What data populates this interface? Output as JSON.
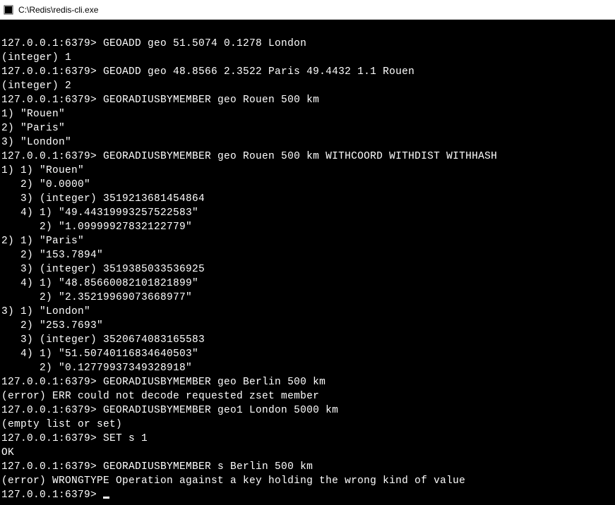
{
  "window": {
    "title": "C:\\Redis\\redis-cli.exe"
  },
  "terminal": {
    "prompt": "127.0.0.1:6379> ",
    "lines": [
      "127.0.0.1:6379> GEOADD geo 51.5074 0.1278 London",
      "(integer) 1",
      "127.0.0.1:6379> GEOADD geo 48.8566 2.3522 Paris 49.4432 1.1 Rouen",
      "(integer) 2",
      "127.0.0.1:6379> GEORADIUSBYMEMBER geo Rouen 500 km",
      "1) \"Rouen\"",
      "2) \"Paris\"",
      "3) \"London\"",
      "127.0.0.1:6379> GEORADIUSBYMEMBER geo Rouen 500 km WITHCOORD WITHDIST WITHHASH",
      "1) 1) \"Rouen\"",
      "   2) \"0.0000\"",
      "   3) (integer) 3519213681454864",
      "   4) 1) \"49.44319993257522583\"",
      "      2) \"1.09999927832122779\"",
      "2) 1) \"Paris\"",
      "   2) \"153.7894\"",
      "   3) (integer) 3519385033536925",
      "   4) 1) \"48.85660082101821899\"",
      "      2) \"2.35219969073668977\"",
      "3) 1) \"London\"",
      "   2) \"253.7693\"",
      "   3) (integer) 3520674083165583",
      "   4) 1) \"51.50740116834640503\"",
      "      2) \"0.12779937349328918\"",
      "127.0.0.1:6379> GEORADIUSBYMEMBER geo Berlin 500 km",
      "(error) ERR could not decode requested zset member",
      "127.0.0.1:6379> GEORADIUSBYMEMBER geo1 London 5000 km",
      "(empty list or set)",
      "127.0.0.1:6379> SET s 1",
      "OK",
      "127.0.0.1:6379> GEORADIUSBYMEMBER s Berlin 500 km",
      "(error) WRONGTYPE Operation against a key holding the wrong kind of value",
      "127.0.0.1:6379> "
    ]
  }
}
